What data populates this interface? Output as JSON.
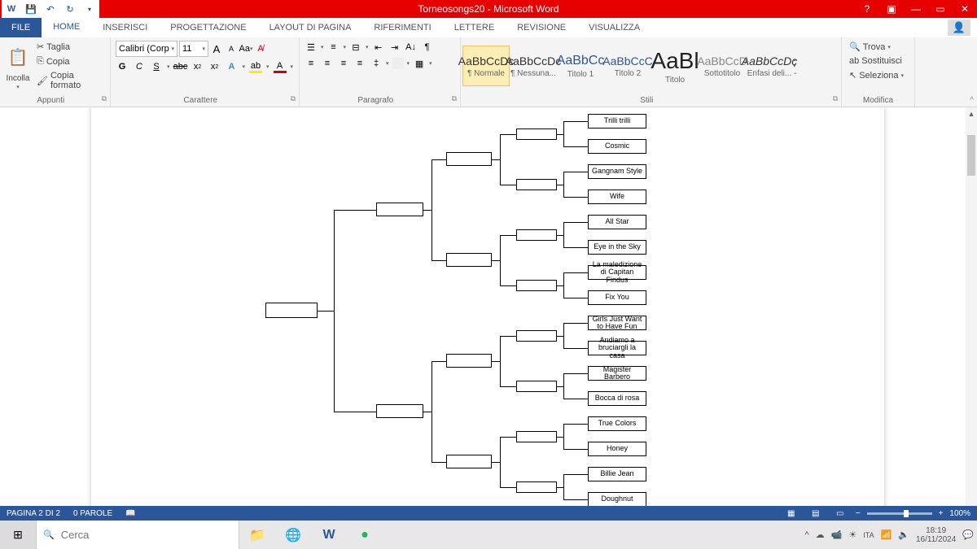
{
  "titlebar": {
    "title": "Torneosongs20 - Microsoft Word"
  },
  "tabs": {
    "file": "FILE",
    "items": [
      "HOME",
      "INSERISCI",
      "PROGETTAZIONE",
      "LAYOUT DI PAGINA",
      "RIFERIMENTI",
      "LETTERE",
      "REVISIONE",
      "VISUALIZZA"
    ],
    "active_index": 0
  },
  "ribbon": {
    "clipboard": {
      "label": "Appunti",
      "paste": "Incolla",
      "cut": "Taglia",
      "copy": "Copia",
      "formatpainter": "Copia formato"
    },
    "font": {
      "label": "Carattere",
      "name": "Calibri (Corp",
      "size": "11"
    },
    "paragraph": {
      "label": "Paragrafo"
    },
    "styles": {
      "label": "Stili",
      "items": [
        {
          "prev": "AaBbCcDc",
          "name": "¶ Normale",
          "sel": true
        },
        {
          "prev": "AaBbCcDc",
          "name": "¶ Nessuna..."
        },
        {
          "prev": "AaBbCc",
          "name": "Titolo 1",
          "color": "#2b579a"
        },
        {
          "prev": "AaBbCcC",
          "name": "Titolo 2",
          "color": "#2b579a"
        },
        {
          "prev": "AaBl",
          "name": "Titolo",
          "big": true
        },
        {
          "prev": "AaBbCcD",
          "name": "Sottotitolo",
          "color": "#888"
        },
        {
          "prev": "AaBbCcDc",
          "name": "Enfasi deli...",
          "italic": true
        }
      ]
    },
    "editing": {
      "label": "Modifica",
      "find": "Trova",
      "replace": "Sostituisci",
      "select": "Seleziona"
    }
  },
  "bracket": {
    "entries": [
      "Trilli trilli",
      "Cosmic",
      "Gangnam Style",
      "Wife",
      "All Star",
      "Eye in the Sky",
      "La maledizione di Capitan Findus",
      "Fix You",
      "Girls Just Want to Have Fun",
      "Andiamo a bruciargli la casa",
      "Magister Barbero",
      "Bocca di rosa",
      "True Colors",
      "Honey",
      "Billie Jean",
      "Doughnut"
    ]
  },
  "statusbar": {
    "page": "PAGINA 2 DI 2",
    "words": "0 PAROLE",
    "zoom": "100%"
  },
  "taskbar": {
    "search_placeholder": "Cerca",
    "time": "18:19",
    "date": "16/11/2024"
  }
}
